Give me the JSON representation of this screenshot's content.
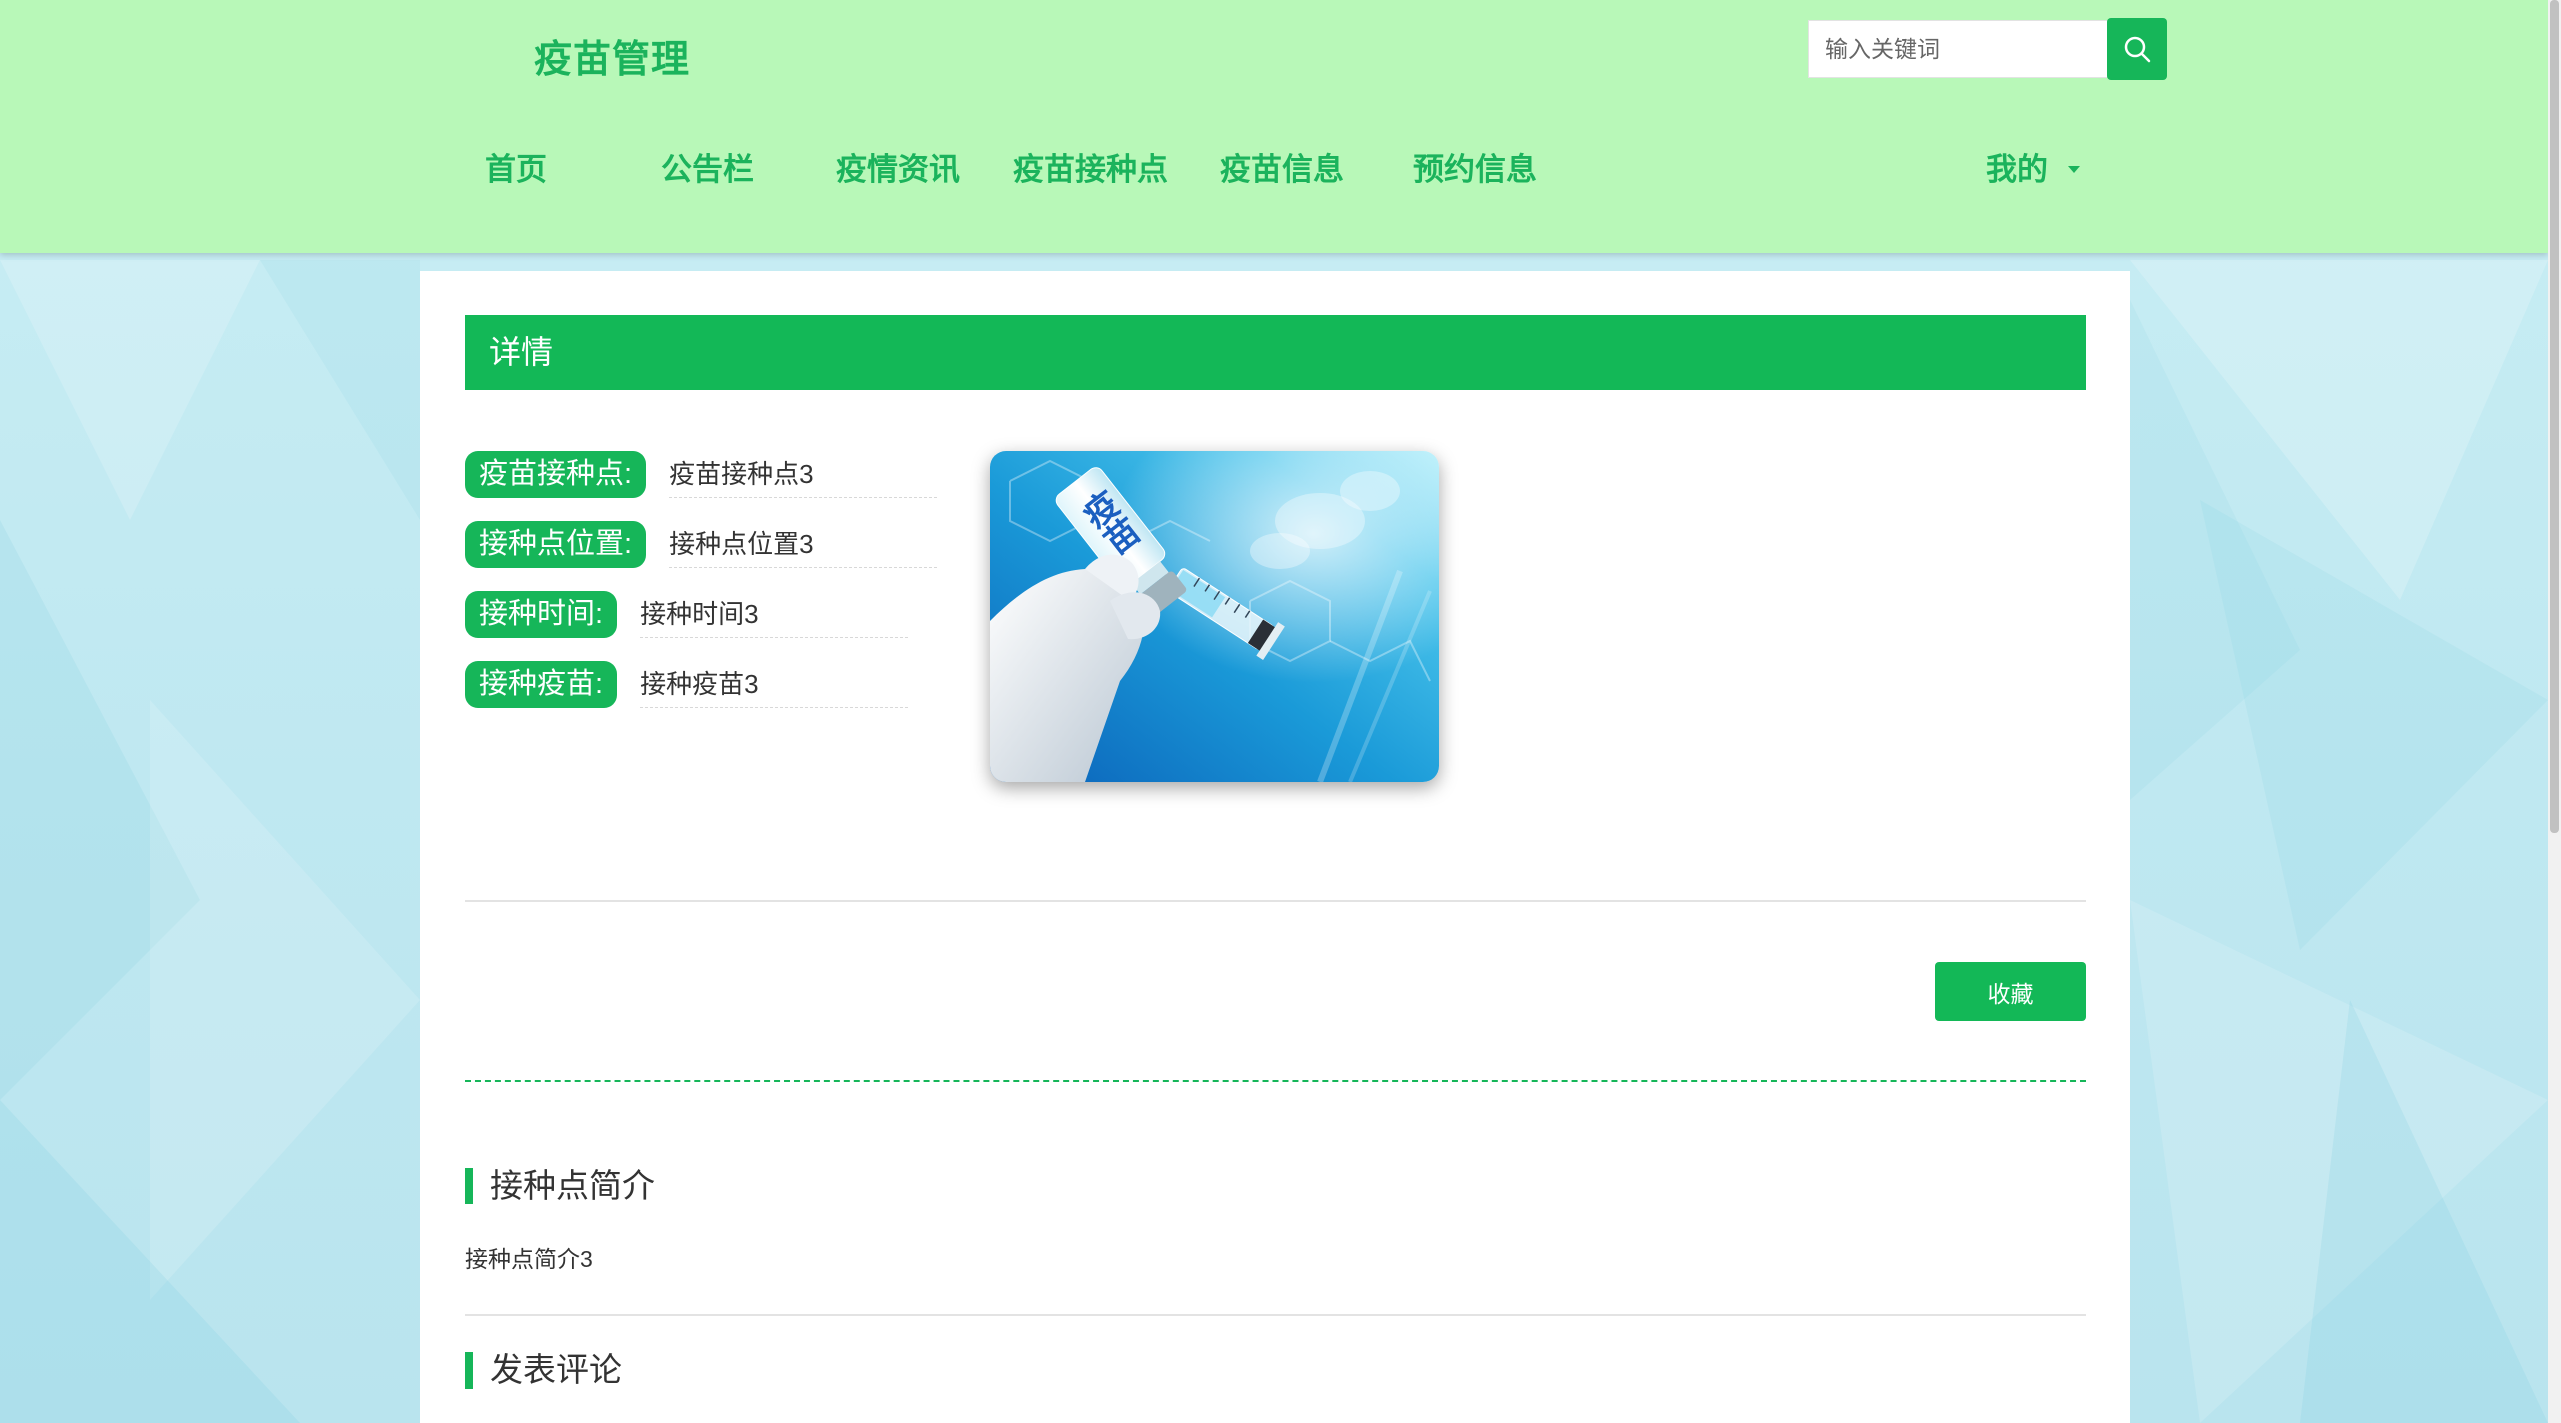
{
  "app": {
    "title": "疫苗管理"
  },
  "search": {
    "placeholder": "输入关键词",
    "icon": "search-icon"
  },
  "nav": {
    "items": [
      {
        "label": "首页"
      },
      {
        "label": "公告栏"
      },
      {
        "label": "疫情资讯"
      },
      {
        "label": "疫苗接种点"
      },
      {
        "label": "疫苗信息"
      },
      {
        "label": "预约信息"
      }
    ],
    "mine": {
      "label": "我的",
      "icon": "caret-down-icon"
    }
  },
  "detail": {
    "header": "详情",
    "fields": [
      {
        "label": "疫苗接种点:",
        "value": "疫苗接种点3"
      },
      {
        "label": "接种点位置:",
        "value": "接种点位置3"
      },
      {
        "label": "接种时间:",
        "value": "接种时间3"
      },
      {
        "label": "接种疫苗:",
        "value": "接种疫苗3"
      }
    ],
    "image": {
      "vial_label": "疫苗"
    },
    "collect_button": "收藏"
  },
  "sections": {
    "intro_title": "接种点简介",
    "intro_text": "接种点简介3",
    "comment_title": "发表评论"
  },
  "colors": {
    "header_bg": "#b8f8b8",
    "accent": "#13b857",
    "nav_text": "#1bb35c",
    "page_bg": "#c9eef4"
  }
}
